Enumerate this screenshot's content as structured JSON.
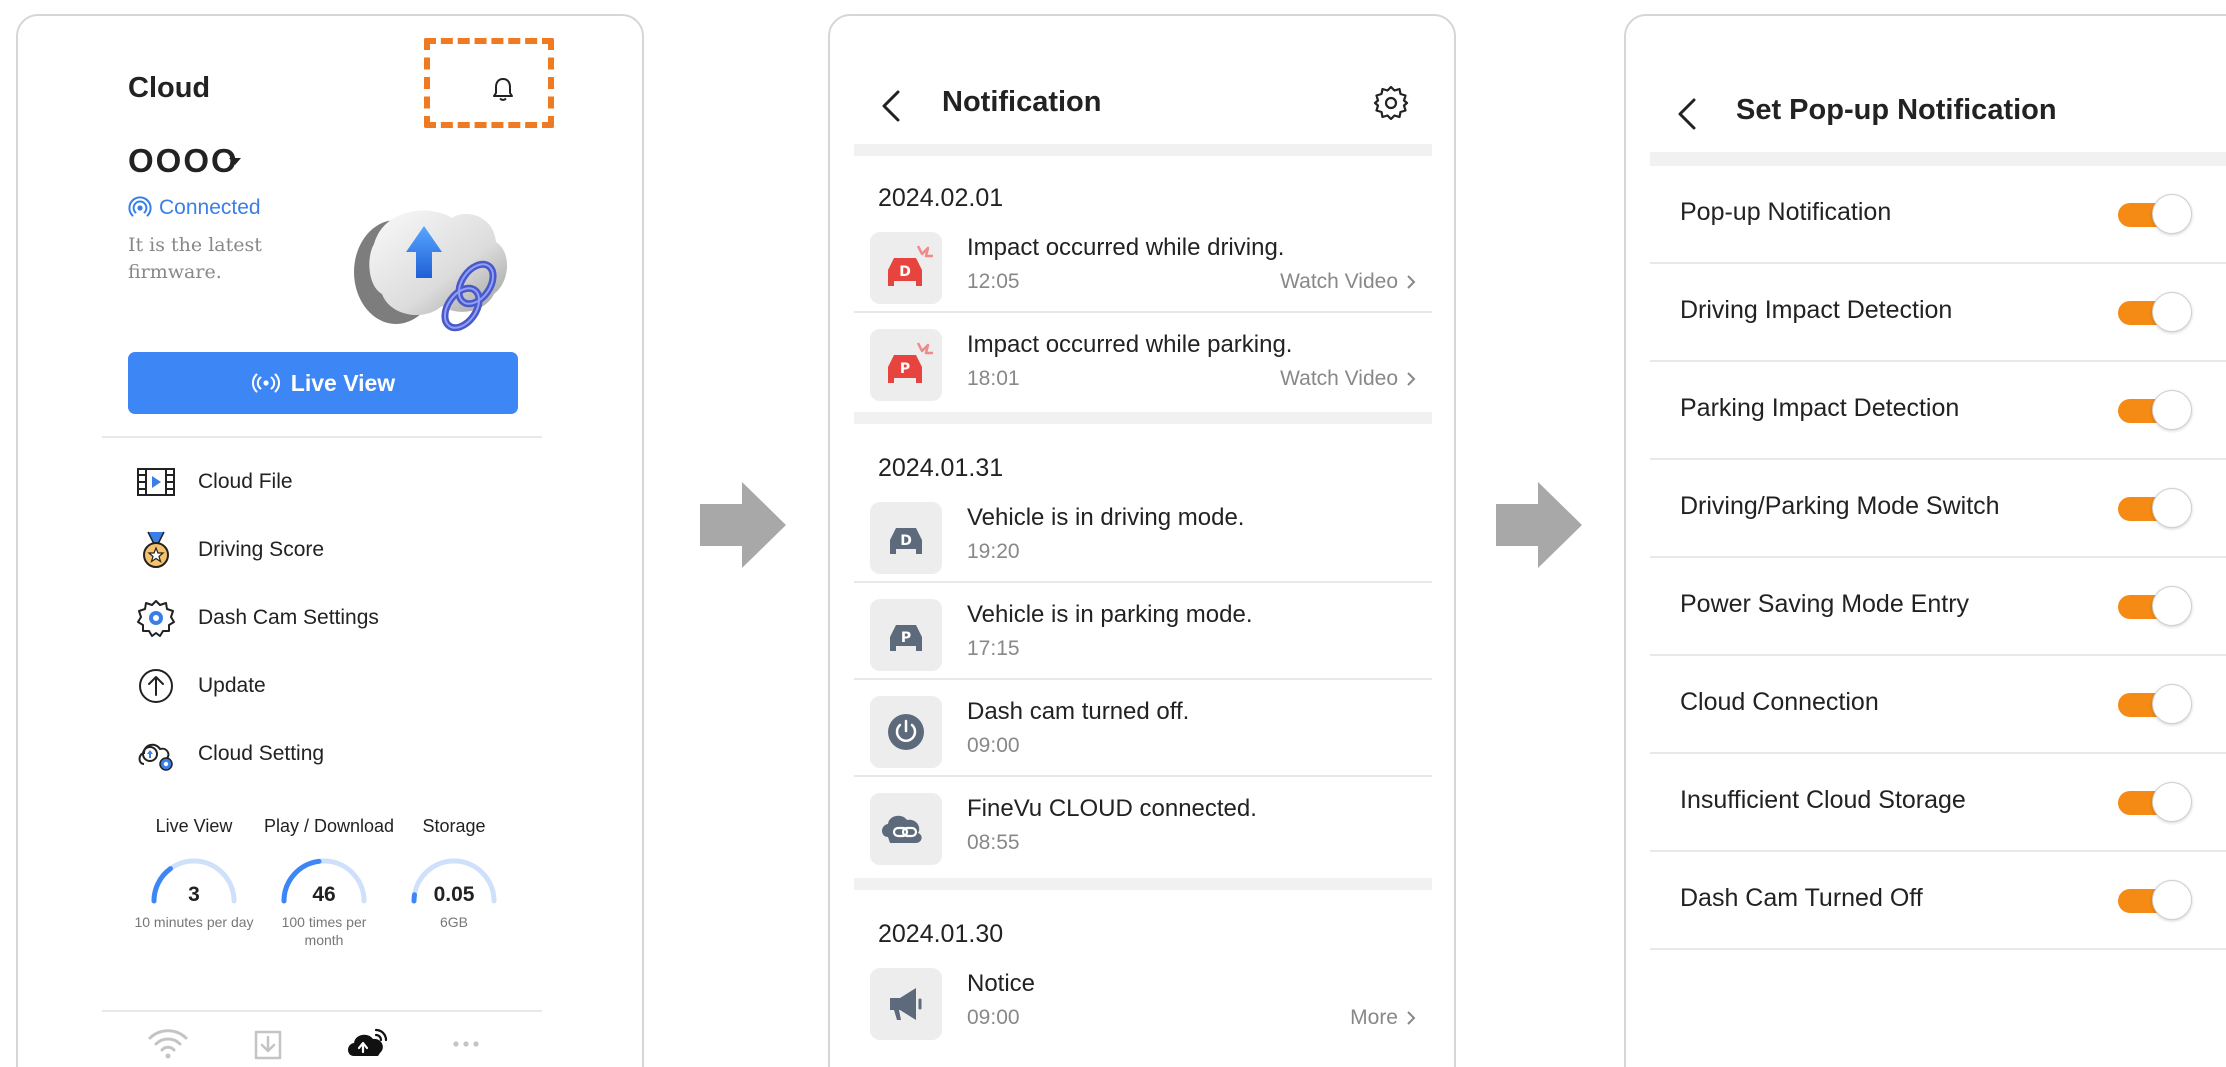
{
  "panel1": {
    "title": "Cloud",
    "device_name": "OOOO",
    "status": "Connected",
    "firmware_text": "It is the latest firmware.",
    "live_view_label": "Live View",
    "menu": [
      {
        "label": "Cloud File",
        "icon": "film-icon"
      },
      {
        "label": "Driving Score",
        "icon": "medal-icon"
      },
      {
        "label": "Dash Cam Settings",
        "icon": "gear-camera-icon"
      },
      {
        "label": "Update",
        "icon": "arrow-up-circle-icon"
      },
      {
        "label": "Cloud Setting",
        "icon": "cloud-gear-icon"
      }
    ],
    "stats": [
      {
        "label": "Live View",
        "value": "3",
        "sub": "10 minutes per day",
        "fraction": 0.3
      },
      {
        "label": "Play / Download",
        "value": "46",
        "sub": "100 times per month",
        "fraction": 0.46
      },
      {
        "label": "Storage",
        "value": "0.05",
        "sub": "6GB",
        "fraction": 0.05
      }
    ],
    "nav": [
      "wifi-icon",
      "download-icon",
      "cloud-icon",
      "more-icon"
    ],
    "highlight_color": "#f07a22",
    "accent_color": "#3d86f5"
  },
  "panel2": {
    "title": "Notification",
    "groups": [
      {
        "date": "2024.02.01",
        "items": [
          {
            "title": "Impact occurred while driving.",
            "time": "12:05",
            "link": "Watch Video",
            "icon": "driving-impact-icon"
          },
          {
            "title": "Impact occurred while parking.",
            "time": "18:01",
            "link": "Watch Video",
            "icon": "parking-impact-icon"
          }
        ]
      },
      {
        "date": "2024.01.31",
        "items": [
          {
            "title": "Vehicle is in driving mode.",
            "time": "19:20",
            "icon": "driving-mode-icon"
          },
          {
            "title": "Vehicle is in parking mode.",
            "time": "17:15",
            "icon": "parking-mode-icon"
          },
          {
            "title": "Dash cam turned off.",
            "time": "09:00",
            "icon": "power-icon"
          },
          {
            "title": "FineVu CLOUD connected.",
            "time": "08:55",
            "icon": "link-icon"
          }
        ]
      },
      {
        "date": "2024.01.30",
        "items": [
          {
            "title": "Notice",
            "time": "09:00",
            "link": "More",
            "icon": "megaphone-icon"
          }
        ]
      }
    ]
  },
  "panel3": {
    "title": "Set Pop-up Notification",
    "toggle_color": "#f58a14",
    "settings": [
      {
        "label": "Pop-up Notification",
        "on": true
      },
      {
        "label": "Driving Impact Detection",
        "on": true
      },
      {
        "label": "Parking Impact Detection",
        "on": true
      },
      {
        "label": "Driving/Parking Mode Switch",
        "on": true
      },
      {
        "label": "Power Saving Mode Entry",
        "on": true
      },
      {
        "label": "Cloud Connection",
        "on": true
      },
      {
        "label": "Insufficient Cloud Storage",
        "on": true
      },
      {
        "label": "Dash Cam Turned Off",
        "on": true
      }
    ]
  }
}
